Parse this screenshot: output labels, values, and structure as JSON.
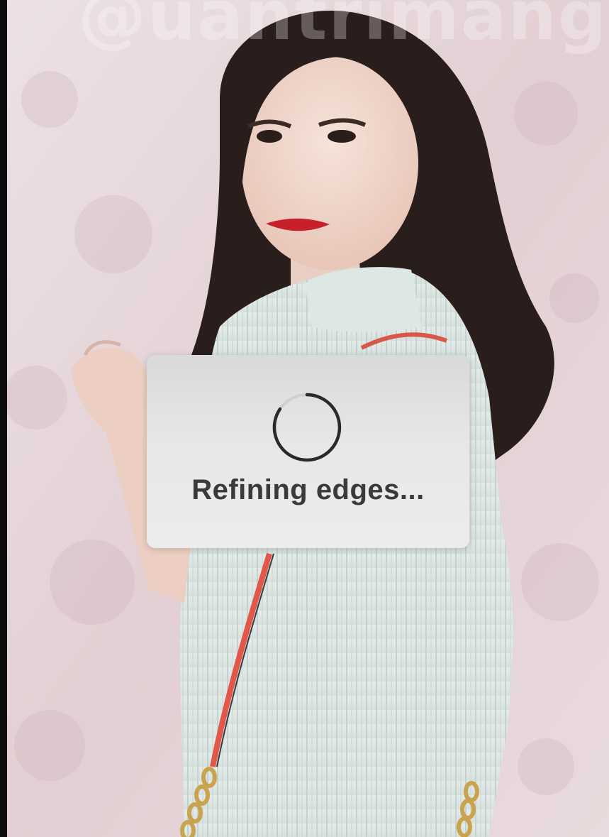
{
  "watermark": {
    "text": "@uantrimang"
  },
  "progress_dialog": {
    "message": "Refining edges...",
    "spinner_icon": "spinner-icon",
    "state": "loading"
  },
  "colors": {
    "background_wall": "#e8d9dc",
    "dialog_background": "#e6e6e6",
    "dialog_text": "#3a3a3a",
    "spinner_stroke": "#2a2a2a"
  }
}
